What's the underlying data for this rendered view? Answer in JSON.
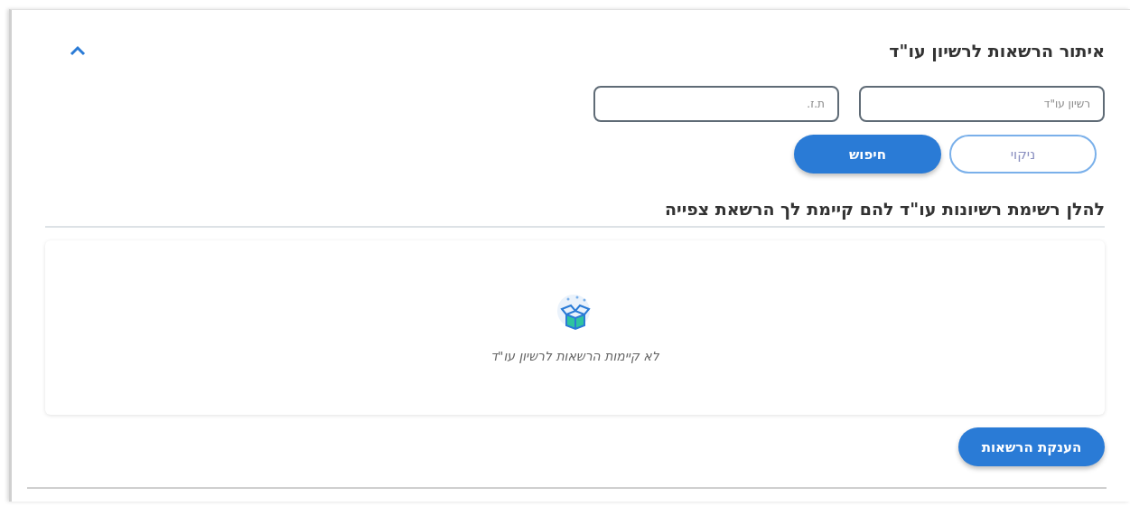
{
  "section": {
    "title": "איתור הרשאות לרשיון עו\"ד",
    "expanded": true
  },
  "fields": [
    {
      "placeholder": "רשיון עו\"ד"
    },
    {
      "placeholder": "ת.ז."
    }
  ],
  "buttons": [
    {
      "label": "ניקוי",
      "kind": "outline"
    },
    {
      "label": "חיפוש",
      "kind": "filled"
    }
  ],
  "list_heading": "להלן רשימת רשיונות עו\"ד להם קיימת לך הרשאת צפייה",
  "empty_state": {
    "message": "לא קיימות הרשאות לרשיון עו\"ד"
  },
  "grant_button": {
    "label": "הענקת הרשאות"
  }
}
